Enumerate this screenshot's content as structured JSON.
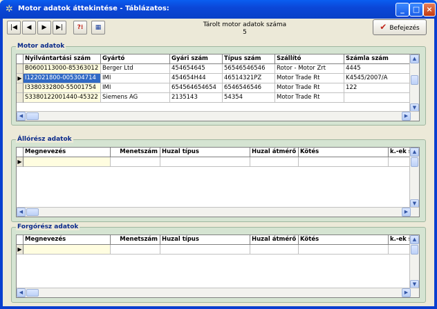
{
  "window": {
    "title": "Motor adatok áttekintése - Táblázatos:"
  },
  "toolbar": {
    "first": "|◀",
    "prev": "◀",
    "next": "▶",
    "last": "▶|",
    "stored_label": "Tárolt motor adatok száma",
    "stored_count": "5",
    "finish_label": "Befejezés"
  },
  "motor": {
    "label": "Motor adatok",
    "columns": [
      "Nyilvántartási szám",
      "Gyártó",
      "Gyári szám",
      "Típus szám",
      "Szállító",
      "Számla szám"
    ],
    "rows": [
      [
        "B0600113000-85363012",
        "Berger Ltd",
        "454654645",
        "56546546546",
        "Rotor - Motor Zrt",
        "4445"
      ],
      [
        "I122021800-005304714",
        "IMI",
        "454654H44",
        "46514321PZ",
        "Motor Trade Rt",
        "K4545/2007/A"
      ],
      [
        "I3380332800-55001754",
        "IMI",
        "654564654654",
        "6546546546",
        "Motor Trade Rt",
        "122"
      ],
      [
        "S3380122001440-45322",
        "Siemens AG",
        "2135143",
        "54354",
        "Motor Trade Rt",
        ""
      ]
    ]
  },
  "allo": {
    "label": "Állórész adatok",
    "columns": [
      "Megnevezés",
      "Menetszám",
      "Huzal típus",
      "Huzal átmérő",
      "Kötés",
      "k.-ek s"
    ]
  },
  "forgo": {
    "label": "Forgórész adatok",
    "columns": [
      "Megnevezés",
      "Menetszám",
      "Huzal típus",
      "Huzal átmérő",
      "Kötés",
      "k.-ek s"
    ]
  }
}
